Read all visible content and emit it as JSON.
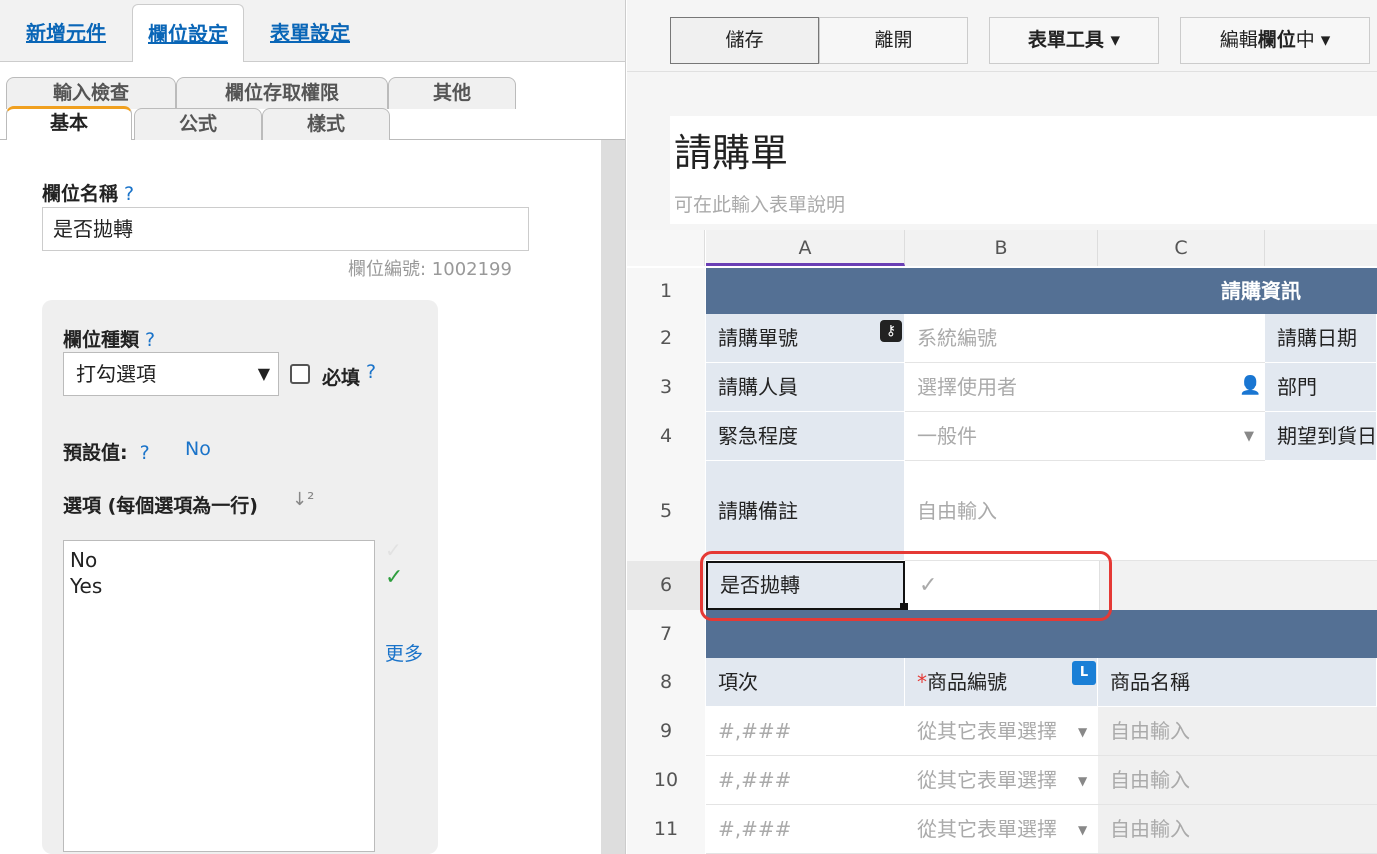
{
  "left_panel": {
    "top_tabs": [
      "新增元件",
      "欄位設定",
      "表單設定"
    ],
    "sub_tabs_row1": [
      "輸入檢查",
      "欄位存取權限",
      "其他"
    ],
    "sub_tabs_row2": [
      "基本",
      "公式",
      "樣式"
    ],
    "field_name_label": "欄位名稱",
    "help": "?",
    "field_name_value": "是否拋轉",
    "field_id": "欄位編號: 1002199",
    "field_type_label": "欄位種類",
    "field_type_value": "打勾選項",
    "required_label": "必填",
    "default_label": "預設值:",
    "default_value": "No",
    "options_label": "選項 (每個選項為一行)",
    "sort_icon": "↓²",
    "options_text": "No\nYes",
    "more": "更多"
  },
  "toolbar": {
    "save": "儲存",
    "leave": "離開",
    "form_tools": "表單工具 ▾",
    "edit_prefix": "編輯",
    "edit_bold": "欄位",
    "edit_suffix": "中 ▾"
  },
  "form": {
    "title": "請購單",
    "description_placeholder": "可在此輸入表單說明"
  },
  "sheet": {
    "columns": [
      "A",
      "B",
      "C"
    ],
    "rows": [
      "1",
      "2",
      "3",
      "4",
      "5",
      "6",
      "7",
      "8",
      "9",
      "10",
      "11"
    ],
    "section_header": "請購資訊",
    "r2": {
      "label": "請購單號",
      "value": "系統編號",
      "label2": "請購日期"
    },
    "r3": {
      "label": "請購人員",
      "value": "選擇使用者",
      "label2": "部門"
    },
    "r4": {
      "label": "緊急程度",
      "value": "一般件",
      "label2": "期望到貨日"
    },
    "r5": {
      "label": "請購備註",
      "value": "自由輸入"
    },
    "r6": {
      "label": "是否拋轉",
      "value": "✓"
    },
    "r8": {
      "c1": "項次",
      "c2_star": "*",
      "c2": "商品編號",
      "badge": "L",
      "c3": "商品名稱"
    },
    "data_rows": [
      {
        "c1": "#,###",
        "c2": "從其它表單選擇",
        "c3": "自由輸入"
      },
      {
        "c1": "#,###",
        "c2": "從其它表單選擇",
        "c3": "自由輸入"
      },
      {
        "c1": "#,###",
        "c2": "從其它表單選擇",
        "c3": "自由輸入"
      }
    ]
  }
}
